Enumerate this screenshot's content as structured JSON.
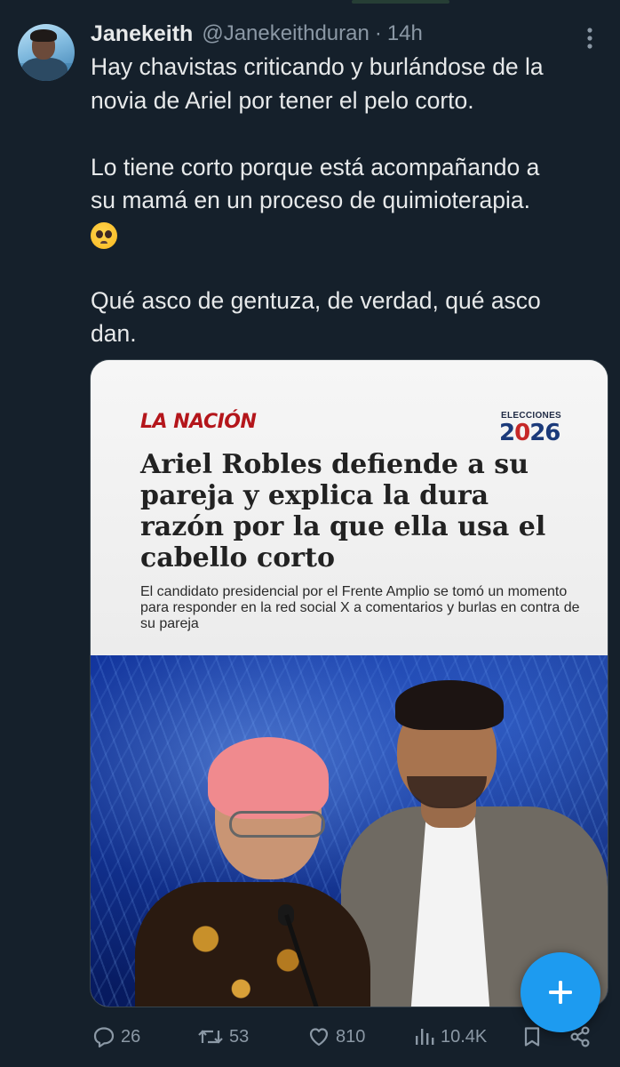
{
  "tweet": {
    "author_name": "Janekeith",
    "author_handle": "@Janekeithduran",
    "separator": "·",
    "time": "14h",
    "text_lines": [
      "Hay chavistas criticando y burlándose de la",
      "novia de Ariel por tener el pelo corto.",
      "",
      "Lo tiene corto porque está acompañando a",
      "su mamá en un proceso de quimioterapia."
    ],
    "emoji": "pleading-face-emoji",
    "text_end": "\nQué asco de gentuza, de verdad, qué asco\ndan."
  },
  "media": {
    "outlet": "LA NACIÓN",
    "election_label": "ELECCIONES",
    "election_year_a": "2",
    "election_year_b": "0",
    "election_year_c": "26",
    "headline": "Ariel Robles defiende a su pareja y explica la dura razón por la que ella usa el cabello corto",
    "subheadline": "El candidato presidencial por el Frente Amplio se tomó un momento para responder en la red social X a comentarios y burlas en contra de su pareja"
  },
  "actions": {
    "replies": "26",
    "reposts": "53",
    "likes": "810",
    "views": "10.4K"
  },
  "icons": {
    "more": "more-vertical-icon",
    "reply": "reply-icon",
    "repost": "repost-icon",
    "like": "heart-icon",
    "views": "views-chart-icon",
    "bookmark": "bookmark-icon",
    "share": "share-icon",
    "compose": "plus-icon"
  },
  "colors": {
    "background": "#15202b",
    "text": "#e7e9ea",
    "muted": "#8b98a5",
    "accent": "#1d9bf0",
    "outlet_red": "#b4161b"
  }
}
